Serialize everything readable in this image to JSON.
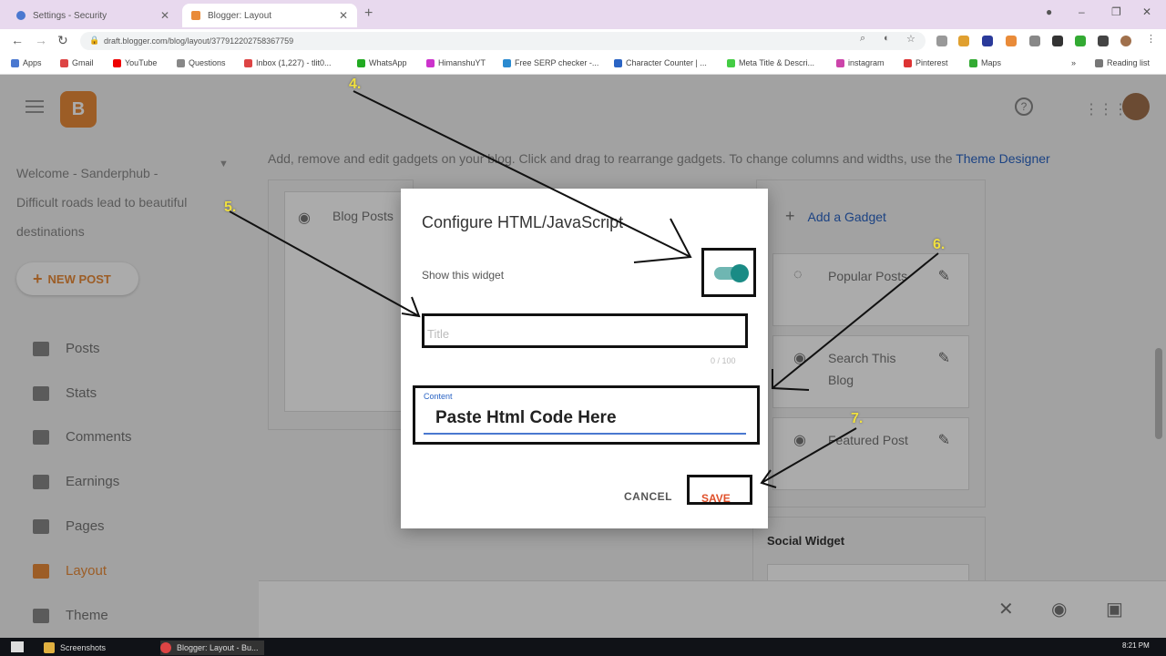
{
  "browser": {
    "tabs": [
      {
        "title": "Settings - Security",
        "favicon_color": "#4a78d0"
      },
      {
        "title": "Blogger: Layout",
        "favicon_color": "#e98b39"
      }
    ],
    "url": "draft.blogger.com/blog/layout/377912202758367759",
    "bookmarks": [
      {
        "label": "Apps",
        "color": "#4a78d0"
      },
      {
        "label": "Gmail",
        "color": "#d44"
      },
      {
        "label": "YouTube",
        "color": "#e00"
      },
      {
        "label": "Questions",
        "color": "#888"
      },
      {
        "label": "Inbox (1,227) - tlit0...",
        "color": "#d44"
      },
      {
        "label": "WhatsApp",
        "color": "#2a2"
      },
      {
        "label": "HimanshuYT",
        "color": "#c3c"
      },
      {
        "label": "Free SERP checker -...",
        "color": "#2a8ad0"
      },
      {
        "label": "Character Counter | ...",
        "color": "#2a64c4"
      },
      {
        "label": "Meta Title & Descri...",
        "color": "#4c4"
      },
      {
        "label": "instagram",
        "color": "#c4a"
      },
      {
        "label": "Pinterest",
        "color": "#d33"
      },
      {
        "label": "Maps",
        "color": "#3a3"
      }
    ],
    "reading_list": "Reading list"
  },
  "blogger": {
    "blog_name": "Welcome - Sanderphub - Difficult roads lead to beautiful destinations",
    "new_post": "NEW POST",
    "nav": [
      {
        "label": "Posts",
        "icon": "posts-icon"
      },
      {
        "label": "Stats",
        "icon": "stats-icon"
      },
      {
        "label": "Comments",
        "icon": "comments-icon"
      },
      {
        "label": "Earnings",
        "icon": "dollar-icon"
      },
      {
        "label": "Pages",
        "icon": "pages-icon"
      },
      {
        "label": "Layout",
        "icon": "layout-icon"
      },
      {
        "label": "Theme",
        "icon": "theme-icon"
      }
    ],
    "hint": "Add, remove and edit gadgets on your blog. Click and drag to rearrange gadgets. To change columns and widths, use the ",
    "hint_link": "Theme Designer",
    "blog_posts_label": "Blog Posts",
    "add_gadget": "Add a Gadget",
    "gadgets": [
      "Popular Posts",
      "Search This Blog",
      "Featured Post"
    ],
    "social_widget": "Social Widget"
  },
  "dialog": {
    "title": "Configure HTML/JavaScript",
    "show_widget_label": "Show this widget",
    "title_placeholder": "Title",
    "title_counter": "0 / 100",
    "content_label": "Content",
    "content_value": "Paste Html Code Here",
    "cancel": "CANCEL",
    "save": "SAVE"
  },
  "annotations": {
    "steps": [
      "4.",
      "5.",
      "6.",
      "7."
    ],
    "color": "#f0e040"
  },
  "taskbar": {
    "items": [
      "Screenshots",
      "Blogger: Layout - Bu..."
    ],
    "time": "8:21 PM"
  }
}
